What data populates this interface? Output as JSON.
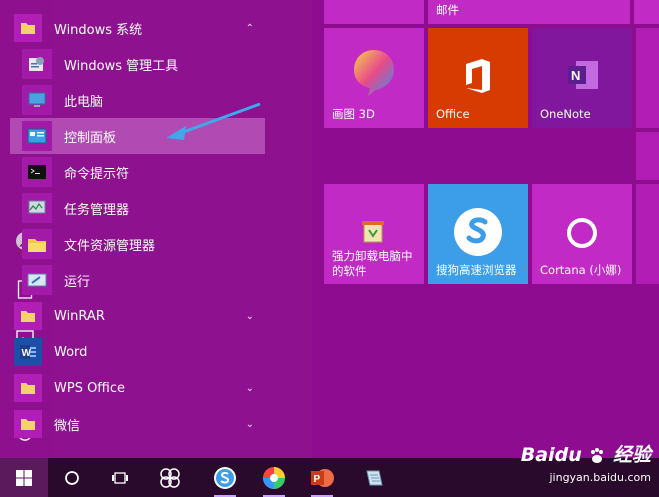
{
  "app_list": {
    "folder_windows": "Windows 系统",
    "items": [
      {
        "label": "Windows 管理工具"
      },
      {
        "label": "此电脑"
      },
      {
        "label": "控制面板"
      },
      {
        "label": "命令提示符"
      },
      {
        "label": "任务管理器"
      },
      {
        "label": "文件资源管理器"
      },
      {
        "label": "运行"
      }
    ],
    "folder_winrar": "WinRAR",
    "word": "Word",
    "folder_wps": "WPS Office",
    "folder_wechat": "微信"
  },
  "tiles": {
    "mail": "邮件",
    "paint3d": "画图 3D",
    "office": "Office",
    "onenote": "OneNote",
    "uninstall_line1": "强力卸载电脑中",
    "uninstall_line2": "的软件",
    "sogou": "搜狗高速浏览器",
    "cortana": "Cortana (小娜)"
  },
  "watermark": {
    "brand": "Baidu",
    "brand_cn": "经验",
    "url": "jingyan.baidu.com"
  },
  "colors": {
    "accent": "#c12ac4",
    "office_tile": "#d83b01",
    "sogou_tile": "#3c9de8",
    "onenote_tile": "#80179d",
    "taskbar": "#2a0a2c",
    "highlight": "#c96fcc",
    "arrow": "#3ea8ea"
  }
}
